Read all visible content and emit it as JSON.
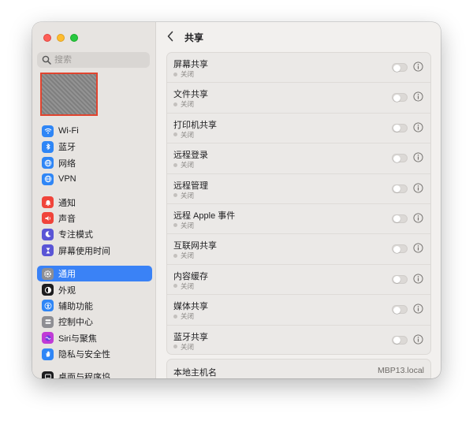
{
  "sidebar": {
    "search_placeholder": "搜索",
    "groups": [
      [
        {
          "label": "Wi-Fi",
          "icon": "wifi-icon",
          "color": "#2f86f6"
        },
        {
          "label": "蓝牙",
          "icon": "bluetooth-icon",
          "color": "#2f86f6"
        },
        {
          "label": "网络",
          "icon": "globe-icon",
          "color": "#2f86f6"
        },
        {
          "label": "VPN",
          "icon": "vpn-globe-icon",
          "color": "#2f86f6"
        }
      ],
      [
        {
          "label": "通知",
          "icon": "bell-icon",
          "color": "#f0443a"
        },
        {
          "label": "声音",
          "icon": "speaker-icon",
          "color": "#f0443a"
        },
        {
          "label": "专注模式",
          "icon": "moon-icon",
          "color": "#5a55d6"
        },
        {
          "label": "屏幕使用时间",
          "icon": "hourglass-icon",
          "color": "#5a55d6"
        }
      ],
      [
        {
          "label": "通用",
          "icon": "gear-icon",
          "color": "#8e8e93",
          "active": true
        },
        {
          "label": "外观",
          "icon": "appearance-icon",
          "color": "#1d1d1f"
        },
        {
          "label": "辅助功能",
          "icon": "accessibility-icon",
          "color": "#2f86f6"
        },
        {
          "label": "控制中心",
          "icon": "control-center-icon",
          "color": "#8e8e93"
        },
        {
          "label": "Siri与聚焦",
          "icon": "siri-icon",
          "color": "#c03bd6"
        },
        {
          "label": "隐私与安全性",
          "icon": "hand-icon",
          "color": "#2f86f6"
        }
      ],
      [
        {
          "label": "桌面与程序坞",
          "icon": "dock-icon",
          "color": "#1d1d1f"
        }
      ]
    ]
  },
  "header": {
    "title": "共享"
  },
  "sharing_items": [
    {
      "label": "屏幕共享",
      "status": "关闭",
      "enabled": false
    },
    {
      "label": "文件共享",
      "status": "关闭",
      "enabled": false
    },
    {
      "label": "打印机共享",
      "status": "关闭",
      "enabled": false
    },
    {
      "label": "远程登录",
      "status": "关闭",
      "enabled": false
    },
    {
      "label": "远程管理",
      "status": "关闭",
      "enabled": false
    },
    {
      "label": "远程 Apple 事件",
      "status": "关闭",
      "enabled": false
    },
    {
      "label": "互联网共享",
      "status": "关闭",
      "enabled": false
    },
    {
      "label": "内容缓存",
      "status": "关闭",
      "enabled": false
    },
    {
      "label": "媒体共享",
      "status": "关闭",
      "enabled": false
    },
    {
      "label": "蓝牙共享",
      "status": "关闭",
      "enabled": false
    }
  ],
  "hostname": {
    "label": "本地主机名",
    "value": "MBP13.local"
  }
}
